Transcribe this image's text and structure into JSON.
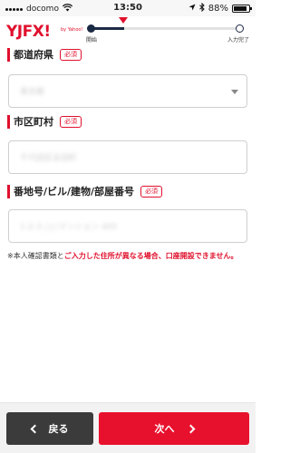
{
  "status": {
    "carrier": "docomo",
    "time": "13:50",
    "battery": "88%",
    "battery_level": 0.88
  },
  "header": {
    "logo": "YJFX!",
    "logo_sub": "by Yahoo!",
    "progress": {
      "start_label": "開始",
      "end_label": "入力完了",
      "position": 0.22
    }
  },
  "form": {
    "required_badge": "必須",
    "prefecture": {
      "label": "都道府県",
      "value": "東京都"
    },
    "city": {
      "label": "市区町村",
      "value": "千代田区永田町"
    },
    "address": {
      "label": "番地号/ビル/建物/部屋番号",
      "value": "1-2-3 ○○マンション 405"
    }
  },
  "note": {
    "prefix": "※本人確認書類と",
    "highlight": "ご入力した住所が異なる場合、口座開設できません。"
  },
  "footer": {
    "back_label": "戻る",
    "next_label": "次へ"
  },
  "colors": {
    "accent": "#e0102d",
    "back_button": "#3b3b3b",
    "progress_done": "#1b2a44"
  }
}
